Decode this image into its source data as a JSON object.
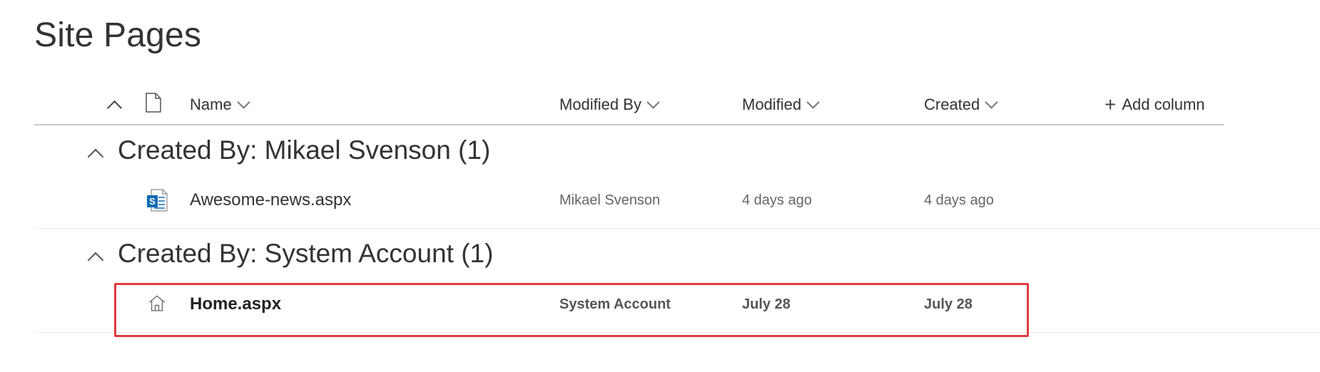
{
  "page": {
    "title": "Site Pages"
  },
  "columns": {
    "name": "Name",
    "modified_by": "Modified By",
    "modified": "Modified",
    "created": "Created",
    "add_column": "Add column"
  },
  "groups": [
    {
      "title": "Created By: Mikael Svenson (1)",
      "rows": [
        {
          "name": "Awesome-news.aspx",
          "modified_by": "Mikael Svenson",
          "modified": "4 days ago",
          "created": "4 days ago",
          "icon": "sharepoint-page-icon"
        }
      ]
    },
    {
      "title": "Created By: System Account (1)",
      "rows": [
        {
          "name": "Home.aspx",
          "modified_by": "System Account",
          "modified": "July 28",
          "created": "July 28",
          "icon": "home-icon"
        }
      ]
    }
  ],
  "colors": {
    "highlight": "#e03a3e",
    "sharepoint_blue": "#0f6ab4"
  }
}
